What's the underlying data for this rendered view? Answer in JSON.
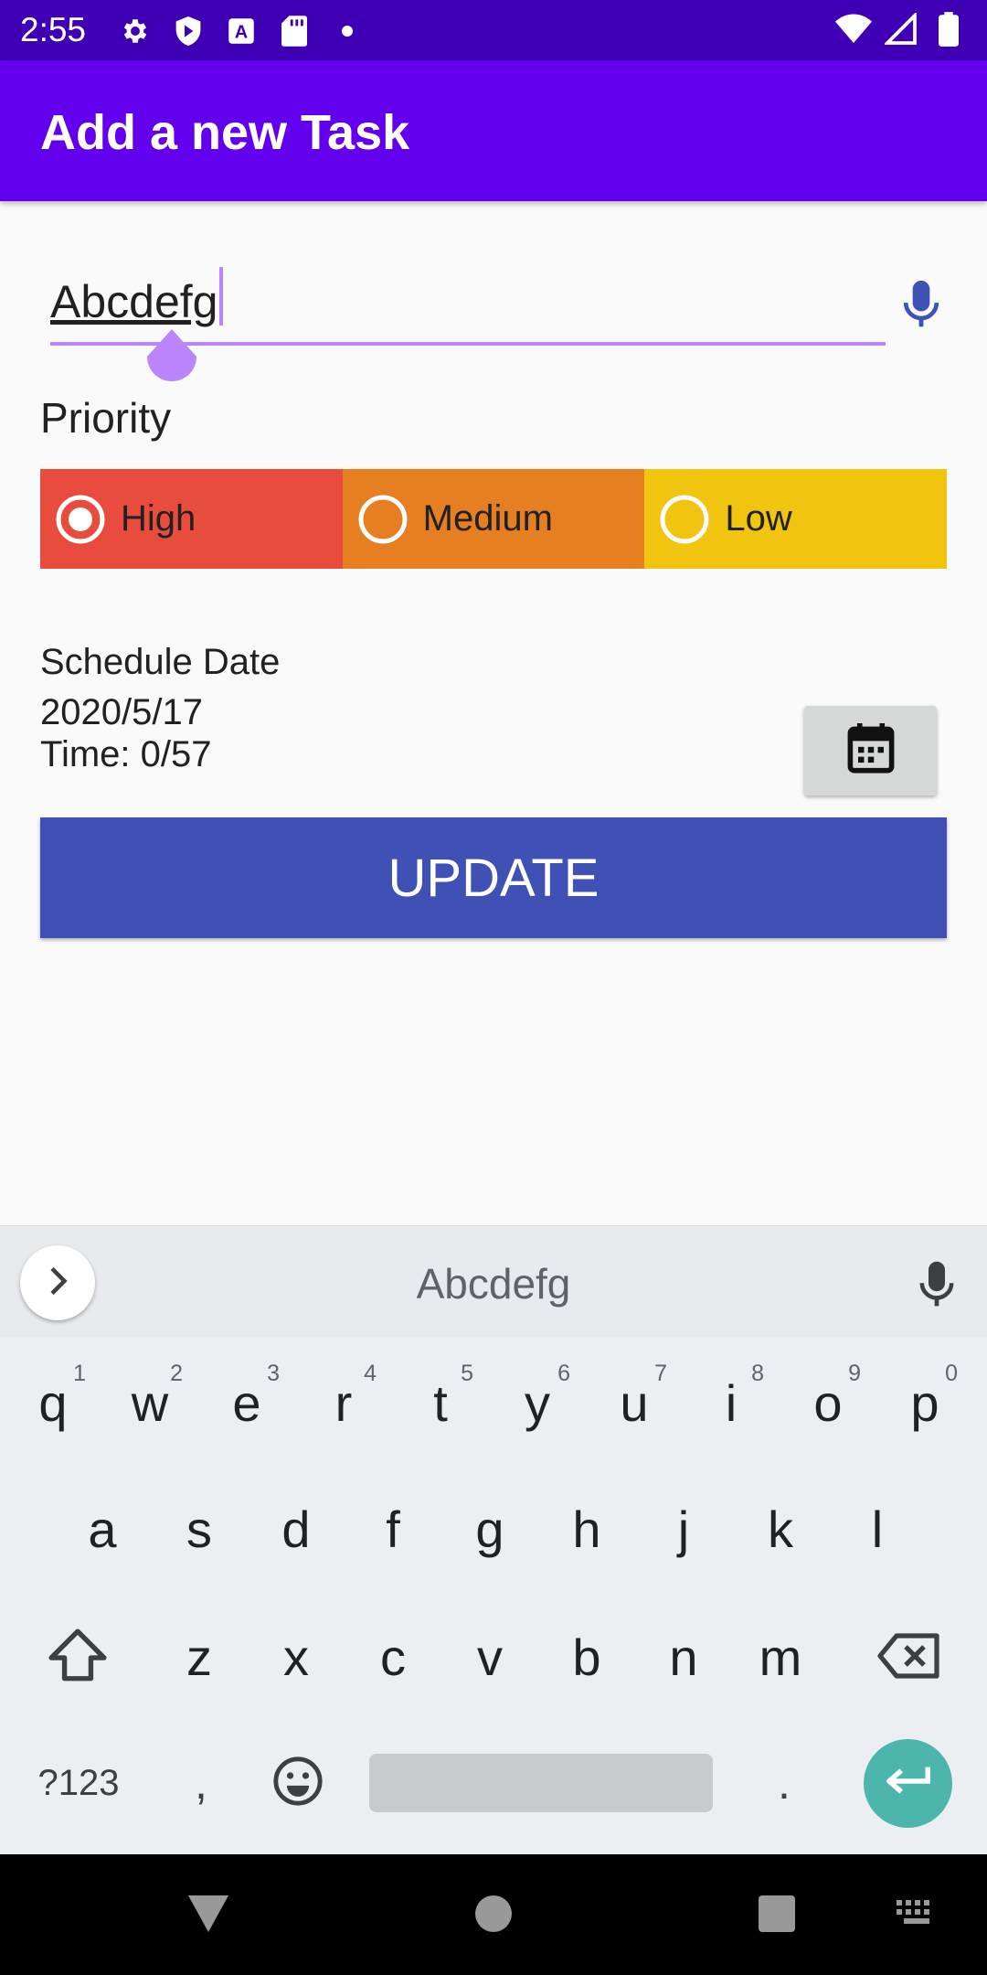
{
  "status_bar": {
    "time": "2:55",
    "left_icons": [
      "settings-icon",
      "shield-icon",
      "a-notification-icon",
      "sd-card-icon",
      "dot-icon"
    ],
    "right_icons": [
      "wifi-icon",
      "signal-icon",
      "battery-icon"
    ]
  },
  "app_bar": {
    "title": "Add a new Task"
  },
  "task": {
    "value": "Abcdefg",
    "placeholder": ""
  },
  "priority": {
    "label": "Priority",
    "options": [
      {
        "label": "High",
        "color": "#e74c3c",
        "selected": true
      },
      {
        "label": "Medium",
        "color": "#e67e22",
        "selected": false
      },
      {
        "label": "Low",
        "color": "#f1c40f",
        "selected": false
      }
    ]
  },
  "schedule": {
    "label": "Schedule Date",
    "date": "2020/5/17",
    "time": "Time: 0/57"
  },
  "update_button": {
    "label": "UPDATE",
    "color": "#3f51b5"
  },
  "keyboard": {
    "suggestion": "Abcdefg",
    "row1": [
      {
        "k": "q",
        "h": "1"
      },
      {
        "k": "w",
        "h": "2"
      },
      {
        "k": "e",
        "h": "3"
      },
      {
        "k": "r",
        "h": "4"
      },
      {
        "k": "t",
        "h": "5"
      },
      {
        "k": "y",
        "h": "6"
      },
      {
        "k": "u",
        "h": "7"
      },
      {
        "k": "i",
        "h": "8"
      },
      {
        "k": "o",
        "h": "9"
      },
      {
        "k": "p",
        "h": "0"
      }
    ],
    "row2": [
      "a",
      "s",
      "d",
      "f",
      "g",
      "h",
      "j",
      "k",
      "l"
    ],
    "row3": [
      "z",
      "x",
      "c",
      "v",
      "b",
      "n",
      "m"
    ],
    "symbols_label": "?123",
    "comma": ",",
    "period": "."
  },
  "colors": {
    "status_bar": "#3f00b5",
    "app_bar": "#6200ee",
    "accent": "#bb86fc",
    "enter_key": "#4db6ac"
  }
}
